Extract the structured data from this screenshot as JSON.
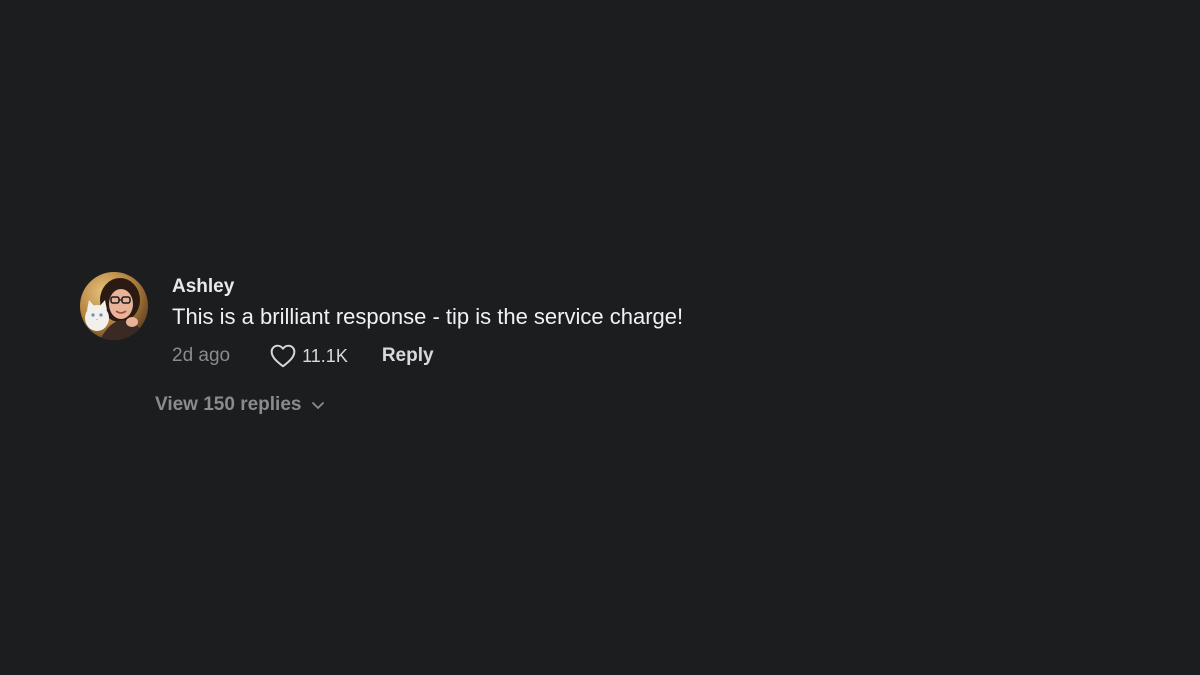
{
  "comment": {
    "username": "Ashley",
    "text": "This is a brilliant response - tip is the service charge!",
    "time": "2d ago",
    "likes": "11.1K",
    "reply_label": "Reply",
    "view_replies_label": "View 150 replies",
    "avatar_icon": "user-avatar-photo",
    "like_icon": "heart-outline-icon",
    "expand_icon": "chevron-down-icon"
  },
  "colors": {
    "background": "#1c1d1f",
    "primary_text": "#f1f1f1",
    "secondary_text": "#8a8b8d"
  }
}
